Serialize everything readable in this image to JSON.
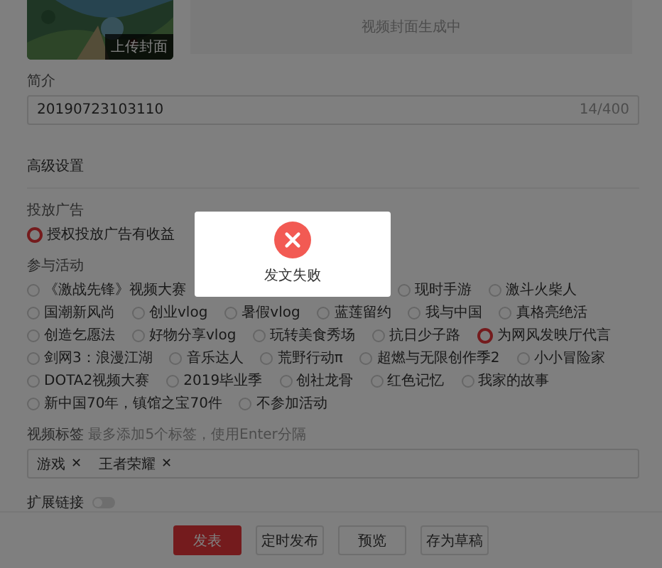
{
  "cover": {
    "button": "上传封面",
    "status": "视频封面生成中"
  },
  "intro": {
    "label": "简介",
    "value": "20190723103110",
    "counter": "14/400"
  },
  "advanced": {
    "title": "高级设置"
  },
  "ads": {
    "label": "投放广告",
    "options": [
      {
        "label": "授权投放广告有收益",
        "selected": true
      }
    ]
  },
  "activities": {
    "label": "参与活动",
    "options": [
      {
        "label": "《激战先锋》视频大赛",
        "selected": false
      },
      {
        "label": "现时手游",
        "selected": false
      },
      {
        "label": "激斗火柴人",
        "selected": false
      },
      {
        "label": "国潮新风尚",
        "selected": false
      },
      {
        "label": "创业vlog",
        "selected": false
      },
      {
        "label": "暑假vlog",
        "selected": false
      },
      {
        "label": "蓝莲留约",
        "selected": false
      },
      {
        "label": "我与中国",
        "selected": false
      },
      {
        "label": "真格亮绝活",
        "selected": false
      },
      {
        "label": "创造乞愿法",
        "selected": false
      },
      {
        "label": "好物分享vlog",
        "selected": false
      },
      {
        "label": "玩转美食秀场",
        "selected": false
      },
      {
        "label": "抗日少子路",
        "selected": false
      },
      {
        "label": "为网风发映厅代言",
        "selected": true
      },
      {
        "label": "剑网3：浪漫江湖",
        "selected": false
      },
      {
        "label": "音乐达人",
        "selected": false
      },
      {
        "label": "荒野行动π",
        "selected": false
      },
      {
        "label": "超燃与无限创作季2",
        "selected": false
      },
      {
        "label": "小小冒险家",
        "selected": false
      },
      {
        "label": "DOTA2视频大赛",
        "selected": false
      },
      {
        "label": "2019毕业季",
        "selected": false
      },
      {
        "label": "创社龙骨",
        "selected": false
      },
      {
        "label": "红色记忆",
        "selected": false
      },
      {
        "label": "我家的故事",
        "selected": false
      },
      {
        "label": "新中国70年，镇馆之宝70件",
        "selected": false
      },
      {
        "label": "不参加活动",
        "selected": false
      }
    ]
  },
  "tags": {
    "label": "视频标签",
    "hint": "最多添加5个标签，使用Enter分隔",
    "items": [
      "游戏",
      "王者荣耀"
    ],
    "remove": "✕"
  },
  "link": {
    "label": "扩展链接",
    "on": false
  },
  "buttons": [
    {
      "label": "发表",
      "kind": "primary"
    },
    {
      "label": "定时发布",
      "kind": "default"
    },
    {
      "label": "预览",
      "kind": "default"
    },
    {
      "label": "存为草稿",
      "kind": "default"
    }
  ],
  "modal": {
    "message": "发文失败"
  }
}
